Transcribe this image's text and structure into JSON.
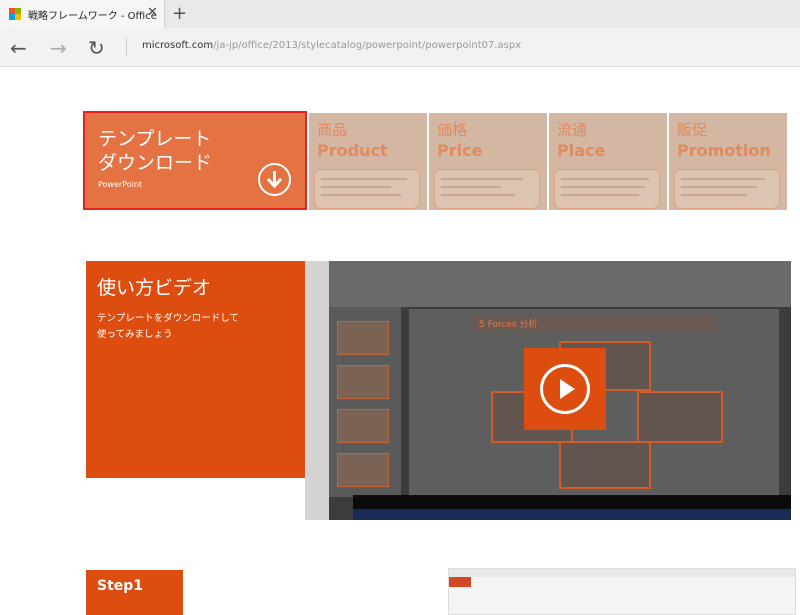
{
  "browser": {
    "tab_title": "戦略フレームワーク - Office",
    "tab_close": "✕",
    "new_tab": "+",
    "back": "←",
    "forward": "→",
    "refresh": "↻",
    "url_domain": "microsoft.com",
    "url_path": "/ja-jp/office/2013/stylecatalog/powerpoint/powerpoint07.aspx"
  },
  "template": {
    "title_line1": "テンプレート",
    "title_line2": "ダウンロード",
    "subtitle": "PowerPoint"
  },
  "framework": [
    {
      "jp": "商品",
      "en": "Product"
    },
    {
      "jp": "価格",
      "en": "Price"
    },
    {
      "jp": "流通",
      "en": "Place"
    },
    {
      "jp": "販促",
      "en": "Promotion"
    }
  ],
  "video": {
    "title": "使い方ビデオ",
    "desc_line1": "テンプレートをダウンロードして",
    "desc_line2": "使ってみましょう",
    "slide_title": "5 Forces 分析"
  },
  "step": {
    "label": "Step1"
  },
  "colors": {
    "accent": "#de4d10",
    "highlight": "#e6221c",
    "tile_fade": "#d3b7a3"
  }
}
